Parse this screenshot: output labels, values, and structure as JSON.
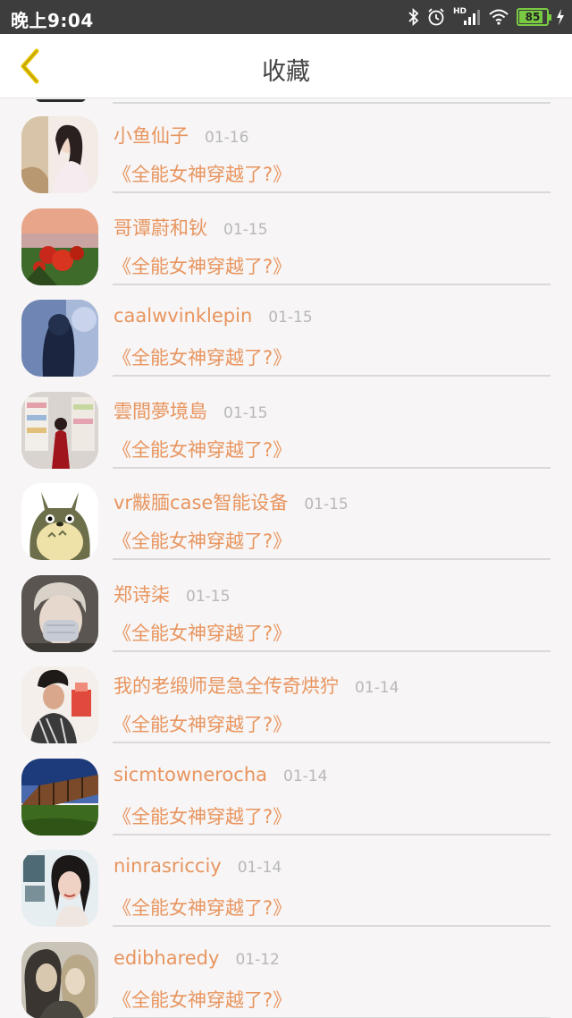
{
  "status_bar": {
    "time": "晚上9:04",
    "network": "HD",
    "battery": "85",
    "battery_level": 0.85,
    "icons": [
      "bluetooth-icon",
      "alarm-icon",
      "signal-icon",
      "wifi-icon",
      "battery-icon",
      "charging-icon"
    ]
  },
  "header": {
    "back_icon": "chevron-left-icon",
    "title": "收藏"
  },
  "colors": {
    "accent": "#e8955f",
    "back_chevron": "#e6c300",
    "status_bar": "#3d3d3d",
    "date": "#b8b8b8",
    "divider": "#d9d9d9"
  },
  "favorites": [
    {
      "name": "小鱼仙子",
      "date": "01-16",
      "book": "《全能女神穿越了?》"
    },
    {
      "name": "哥谭蔚和钬",
      "date": "01-15",
      "book": "《全能女神穿越了?》"
    },
    {
      "name": "caalwvinklepin",
      "date": "01-15",
      "book": "《全能女神穿越了?》"
    },
    {
      "name": "雲間夢境島",
      "date": "01-15",
      "book": "《全能女神穿越了?》"
    },
    {
      "name": "vr黻腼case智能设备",
      "date": "01-15",
      "book": "《全能女神穿越了?》"
    },
    {
      "name": "郑诗柒",
      "date": "01-15",
      "book": "《全能女神穿越了?》"
    },
    {
      "name": "我的老缎师是急全传奇烘狞",
      "date": "01-14",
      "book": "《全能女神穿越了?》"
    },
    {
      "name": "sicmtownerocha",
      "date": "01-14",
      "book": "《全能女神穿越了?》"
    },
    {
      "name": "ninrasricciy",
      "date": "01-14",
      "book": "《全能女神穿越了?》"
    },
    {
      "name": "edibharedy",
      "date": "01-12",
      "book": "《全能女神穿越了?》"
    }
  ]
}
